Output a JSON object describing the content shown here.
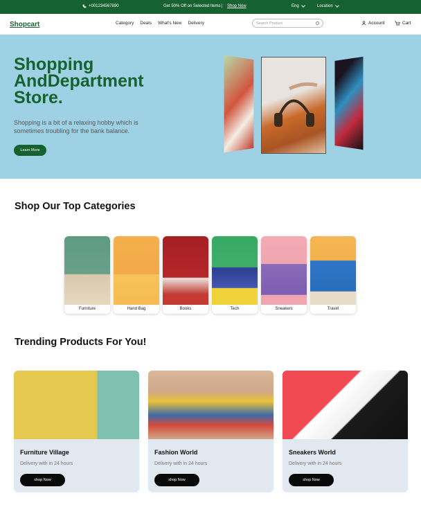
{
  "topbar": {
    "phone": "+001234567890",
    "promo": "Get 50% Off on Selected Items",
    "separator": "|",
    "shop_now": "Shop Now",
    "language": "Eng",
    "location": "Location"
  },
  "nav": {
    "logo": "Shopcart",
    "menu": [
      "Category",
      "Deals",
      "What's New",
      "Delivery"
    ],
    "search_placeholder": "Search Product",
    "account": "Account",
    "cart": "Cart"
  },
  "hero": {
    "title": "Shopping AndDepartment Store.",
    "subtitle": "Shopping is a bit of a relaxing hobby which is sometimes troubling for the bank balance.",
    "cta": "Learn More"
  },
  "categories": {
    "title": "Shop Our Top Categories",
    "items": [
      {
        "label": "Furniture",
        "color": "#6aa08a"
      },
      {
        "label": "Hand Bag",
        "color": "#f2a94a"
      },
      {
        "label": "Books",
        "color": "#b5262a"
      },
      {
        "label": "Tech",
        "color": "#3fae6a"
      },
      {
        "label": "Sneakers",
        "color": "#f0a6b0"
      },
      {
        "label": "Travel",
        "color": "#f3b24d"
      }
    ]
  },
  "trending": {
    "title": "Trending Products For You!",
    "items": [
      {
        "name": "Furniture Village",
        "delivery": "Delivery with in 24 hours",
        "button": "shop Now"
      },
      {
        "name": "Fashion World",
        "delivery": "Delivery with in 24 hours",
        "button": "shop Now"
      },
      {
        "name": "Sneakers World",
        "delivery": "Delivery with in 24 hours",
        "button": "shop Now"
      }
    ]
  },
  "colors": {
    "brand_green": "#15612f",
    "hero_bg": "#9fd1e4",
    "card_bg": "#e2e8f0"
  }
}
